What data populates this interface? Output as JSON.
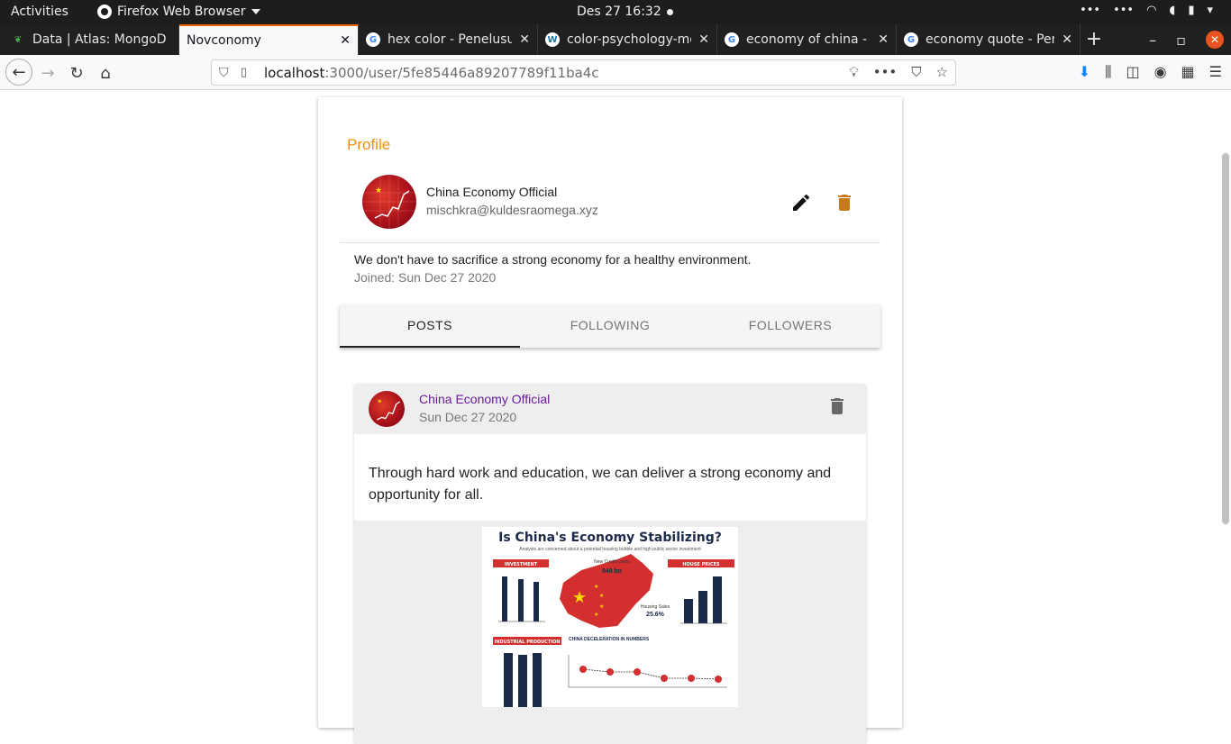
{
  "system": {
    "activities": "Activities",
    "app_name": "Firefox Web Browser",
    "clock": "Des 27  16:32"
  },
  "browser": {
    "tabs": [
      {
        "label": "Data | Atlas: MongoD",
        "active": false
      },
      {
        "label": "Novconomy",
        "active": true
      },
      {
        "label": "hex color - Penelusur",
        "active": false
      },
      {
        "label": "color-psychology-me",
        "active": false
      },
      {
        "label": "economy of china - G",
        "active": false
      },
      {
        "label": "economy quote - Pen",
        "active": false
      }
    ],
    "url_host": "localhost",
    "url_path": ":3000/user/5fe85446a89207789f11ba4c"
  },
  "profile": {
    "section_title": "Profile",
    "name": "China Economy Official",
    "email": "mischkra@kuldesraomega.xyz",
    "bio": "We don't have to sacrifice a strong economy for a healthy environment.",
    "joined": "Joined: Sun Dec 27 2020"
  },
  "profile_tabs": [
    {
      "label": "POSTS",
      "active": true
    },
    {
      "label": "FOLLOWING",
      "active": false
    },
    {
      "label": "FOLLOWERS",
      "active": false
    }
  ],
  "post": {
    "author": "China Economy Official",
    "date": "Sun Dec 27 2020",
    "text": "Through hard work and education, we can deliver a strong economy and opportunity for all.",
    "image": {
      "title": "Is China's Economy Stabilizing?",
      "subtitle": "Analysts are concerned about a potential housing bubble and high public sector investment",
      "investment_label": "INVESTMENT",
      "house_prices_label": "HOUSE PRICES",
      "industrial_label": "INDUSTRIAL PRODUCTION",
      "deceleration_label": "CHINA DECELERATION IN NUMBERS",
      "loans_label": "New Credit Loans",
      "loans_value": "949 bn",
      "sales_label": "Housing Sales",
      "sales_value": "25.6%"
    }
  },
  "colors": {
    "accent_orange": "#f0900a",
    "author_purple": "#6a1b9a",
    "trash_brown": "#c77a1a",
    "firefox_accent": "#e66000"
  }
}
